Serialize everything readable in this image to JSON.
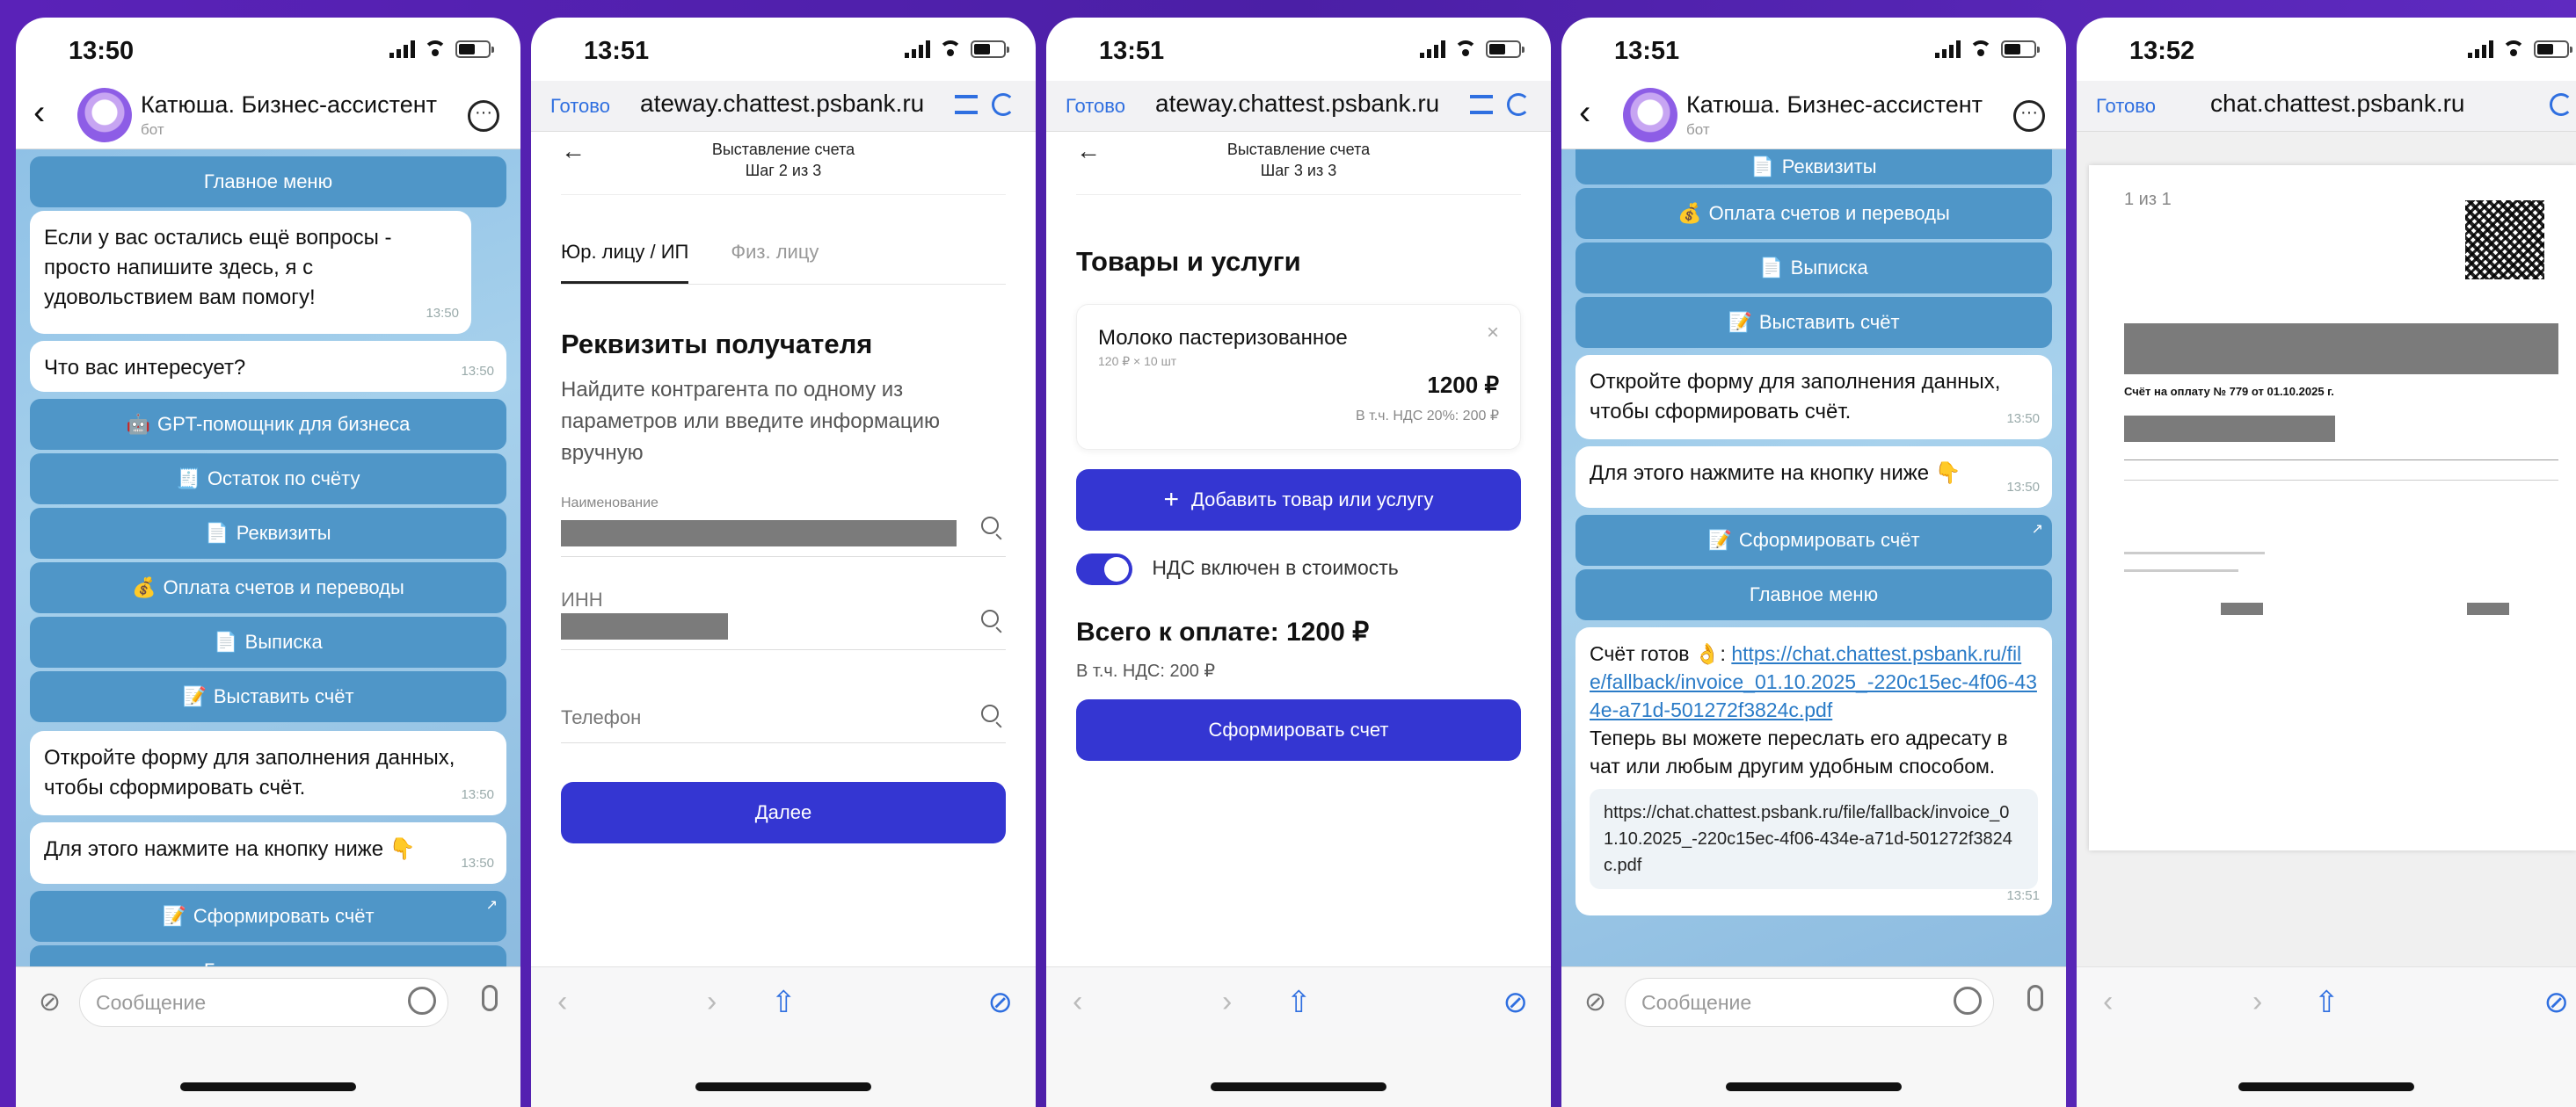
{
  "status": {
    "phone1_time": "13:50",
    "phone2_time": "13:51",
    "phone3_time": "13:51",
    "phone4_time": "13:51",
    "phone5_time": "13:52"
  },
  "chat": {
    "title": "Катюша. Бизнес-ассистент",
    "subtitle": "бот",
    "input_placeholder": "Сообщение",
    "main_menu": "Главное меню",
    "bubble_questions": "Если у вас остались ещё вопросы - просто напишите здесь, я с удовольствием вам помогу!",
    "bubble_questions_time": "13:50",
    "bubble_interest": "Что вас интересует?",
    "bubble_interest_time": "13:50",
    "btn_gpt": "GPT-помощник для бизнеса",
    "btn_balance": "Остаток по счёту",
    "btn_requisites": "Реквизиты",
    "btn_payments": "Оплата счетов и переводы",
    "btn_statement": "Выписка",
    "btn_invoice": "Выставить счёт",
    "bubble_form": "Откройте форму для заполнения данных, чтобы сформировать счёт.",
    "bubble_form_time": "13:50",
    "bubble_press": "Для этого нажмите на кнопку ниже",
    "bubble_press_time": "13:50",
    "btn_make_invoice": "Сформировать счёт",
    "bubble_form_time2": "13:50",
    "bubble_press_time2": "13:50",
    "ready_prefix": "Счёт готов",
    "ready_link": "https://chat.chattest.psbank.ru/file/fallback/invoice_01.10.2025_-220c15ec-4f06-434e-a71d-501272f3824c.pdf",
    "ready_text": "Теперь вы можете переслать его адресату в чат или любым другим удобным способом.",
    "preview_text": "https://chat.chattest.psbank.ru/file/fallback/invoice_01.10.2025_-220c15ec-4f06-434e-a71d-501272f3824c.pdf",
    "ready_time": "13:51"
  },
  "web": {
    "done": "Готово",
    "url_short": "ateway.chattest.psbank.ru",
    "url_short2": "ateway.chattest.psbank.ru",
    "url_pdf": "chat.chattest.psbank.ru"
  },
  "step2": {
    "title": "Выставление счета",
    "step": "Шаг 2 из 3",
    "tab_legal": "Юр. лицу / ИП",
    "tab_person": "Физ. лицу",
    "heading": "Реквизиты получателя",
    "hint": "Найдите контрагента по одному из параметров или введите информацию вручную",
    "field_name": "Наименование",
    "field_inn": "ИНН",
    "field_phone": "Телефон",
    "next": "Далее"
  },
  "step3": {
    "title": "Выставление счета",
    "step": "Шаг 3 из 3",
    "heading": "Товары и услуги",
    "item_name": "Молоко пастеризованное",
    "item_qty": "120 ₽ × 10 шт",
    "item_sum": "1200 ₽",
    "item_vat": "В т.ч. НДС 20%: 200 ₽",
    "add_item": "Добавить товар или услугу",
    "vat_toggle": "НДС включен в стоимость",
    "total": "Всего к оплате: 1200 ₽",
    "total_vat": "В т.ч. НДС: 200 ₽",
    "make": "Сформировать счет"
  },
  "pdf": {
    "pages": "1 из 1",
    "invoice_title": "Счёт на оплату № 779 от 01.10.2025 г."
  }
}
